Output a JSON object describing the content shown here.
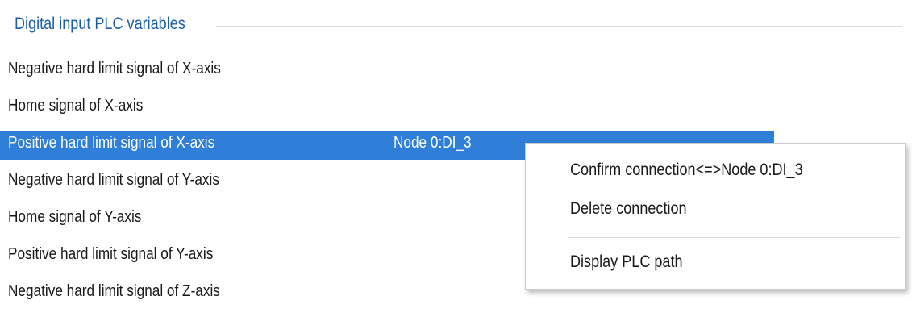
{
  "group": {
    "title": "Digital input PLC variables"
  },
  "variables": [
    {
      "label": "Negative hard limit signal of X-axis",
      "connection": ""
    },
    {
      "label": "Home signal of X-axis",
      "connection": ""
    },
    {
      "label": "Positive hard limit signal of X-axis",
      "connection": "Node 0:DI_3"
    },
    {
      "label": "Negative hard limit signal of Y-axis",
      "connection": ""
    },
    {
      "label": "Home signal of Y-axis",
      "connection": ""
    },
    {
      "label": "Positive hard limit signal of Y-axis",
      "connection": ""
    },
    {
      "label": "Negative hard limit signal of Z-axis",
      "connection": ""
    }
  ],
  "selected_row": 2,
  "context_menu": {
    "confirm": "Confirm connection<=>Node 0:DI_3",
    "delete": "Delete connection",
    "display_path": "Display PLC path"
  },
  "colors": {
    "selection": "#2f7fd8",
    "group_title": "#1d5fa8"
  }
}
